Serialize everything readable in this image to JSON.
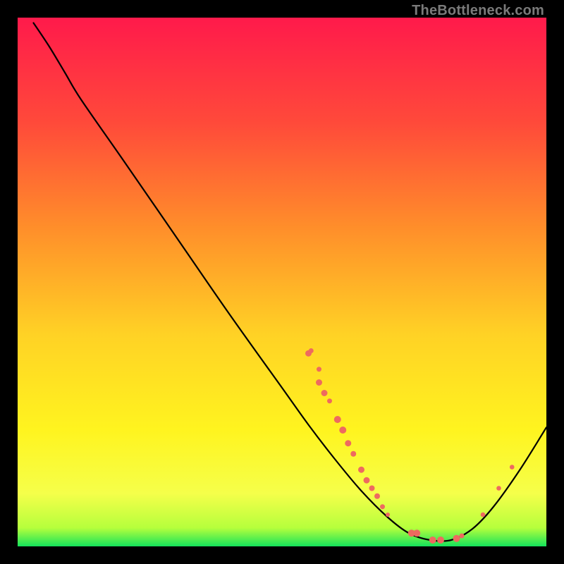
{
  "watermark": "TheBottleneck.com",
  "chart_data": {
    "type": "line",
    "title": "",
    "xlabel": "",
    "ylabel": "",
    "xlim": [
      0,
      100
    ],
    "ylim": [
      0,
      100
    ],
    "grid": false,
    "legend": false,
    "gradient_stops": [
      {
        "offset": 0.0,
        "color": "#ff1a4b"
      },
      {
        "offset": 0.2,
        "color": "#ff4a3a"
      },
      {
        "offset": 0.4,
        "color": "#ff8f2a"
      },
      {
        "offset": 0.6,
        "color": "#ffd225"
      },
      {
        "offset": 0.78,
        "color": "#fff41f"
      },
      {
        "offset": 0.9,
        "color": "#f5ff4a"
      },
      {
        "offset": 0.965,
        "color": "#b6ff3c"
      },
      {
        "offset": 1.0,
        "color": "#14e35b"
      }
    ],
    "curve": [
      {
        "x": 3.0,
        "y": 99.0
      },
      {
        "x": 6.0,
        "y": 94.5
      },
      {
        "x": 9.0,
        "y": 89.5
      },
      {
        "x": 12.0,
        "y": 84.5
      },
      {
        "x": 20.0,
        "y": 73.0
      },
      {
        "x": 30.0,
        "y": 58.5
      },
      {
        "x": 40.0,
        "y": 44.0
      },
      {
        "x": 50.0,
        "y": 30.0
      },
      {
        "x": 55.0,
        "y": 23.0
      },
      {
        "x": 60.0,
        "y": 16.5
      },
      {
        "x": 65.0,
        "y": 10.5
      },
      {
        "x": 70.0,
        "y": 5.5
      },
      {
        "x": 74.0,
        "y": 2.5
      },
      {
        "x": 78.0,
        "y": 1.2
      },
      {
        "x": 82.0,
        "y": 1.2
      },
      {
        "x": 86.0,
        "y": 3.3
      },
      {
        "x": 90.0,
        "y": 7.5
      },
      {
        "x": 95.0,
        "y": 14.5
      },
      {
        "x": 100.0,
        "y": 22.5
      }
    ],
    "dot_clusters": [
      {
        "x": 55.0,
        "y": 36.5,
        "r": 4.5
      },
      {
        "x": 55.5,
        "y": 37.0,
        "r": 3.5
      },
      {
        "x": 57.0,
        "y": 33.5,
        "r": 3.5
      },
      {
        "x": 57.0,
        "y": 31.0,
        "r": 4.5
      },
      {
        "x": 58.0,
        "y": 29.0,
        "r": 4.5
      },
      {
        "x": 59.0,
        "y": 27.5,
        "r": 3.5
      },
      {
        "x": 60.5,
        "y": 24.0,
        "r": 5.0
      },
      {
        "x": 61.5,
        "y": 22.0,
        "r": 5.0
      },
      {
        "x": 62.5,
        "y": 19.5,
        "r": 4.5
      },
      {
        "x": 63.5,
        "y": 17.5,
        "r": 4.0
      },
      {
        "x": 65.0,
        "y": 14.5,
        "r": 4.5
      },
      {
        "x": 66.0,
        "y": 12.5,
        "r": 4.5
      },
      {
        "x": 67.0,
        "y": 11.0,
        "r": 4.0
      },
      {
        "x": 68.0,
        "y": 9.5,
        "r": 4.0
      },
      {
        "x": 69.0,
        "y": 7.5,
        "r": 3.5
      },
      {
        "x": 70.0,
        "y": 6.0,
        "r": 3.0
      },
      {
        "x": 74.5,
        "y": 2.5,
        "r": 5.0
      },
      {
        "x": 75.5,
        "y": 2.5,
        "r": 5.0
      },
      {
        "x": 78.5,
        "y": 1.2,
        "r": 5.0
      },
      {
        "x": 80.0,
        "y": 1.2,
        "r": 5.0
      },
      {
        "x": 83.0,
        "y": 1.5,
        "r": 5.0
      },
      {
        "x": 84.0,
        "y": 2.0,
        "r": 3.5
      },
      {
        "x": 88.0,
        "y": 6.0,
        "r": 3.3
      },
      {
        "x": 91.0,
        "y": 11.0,
        "r": 3.3
      },
      {
        "x": 93.5,
        "y": 15.0,
        "r": 3.3
      }
    ],
    "dot_color": "#ee6a5f"
  }
}
